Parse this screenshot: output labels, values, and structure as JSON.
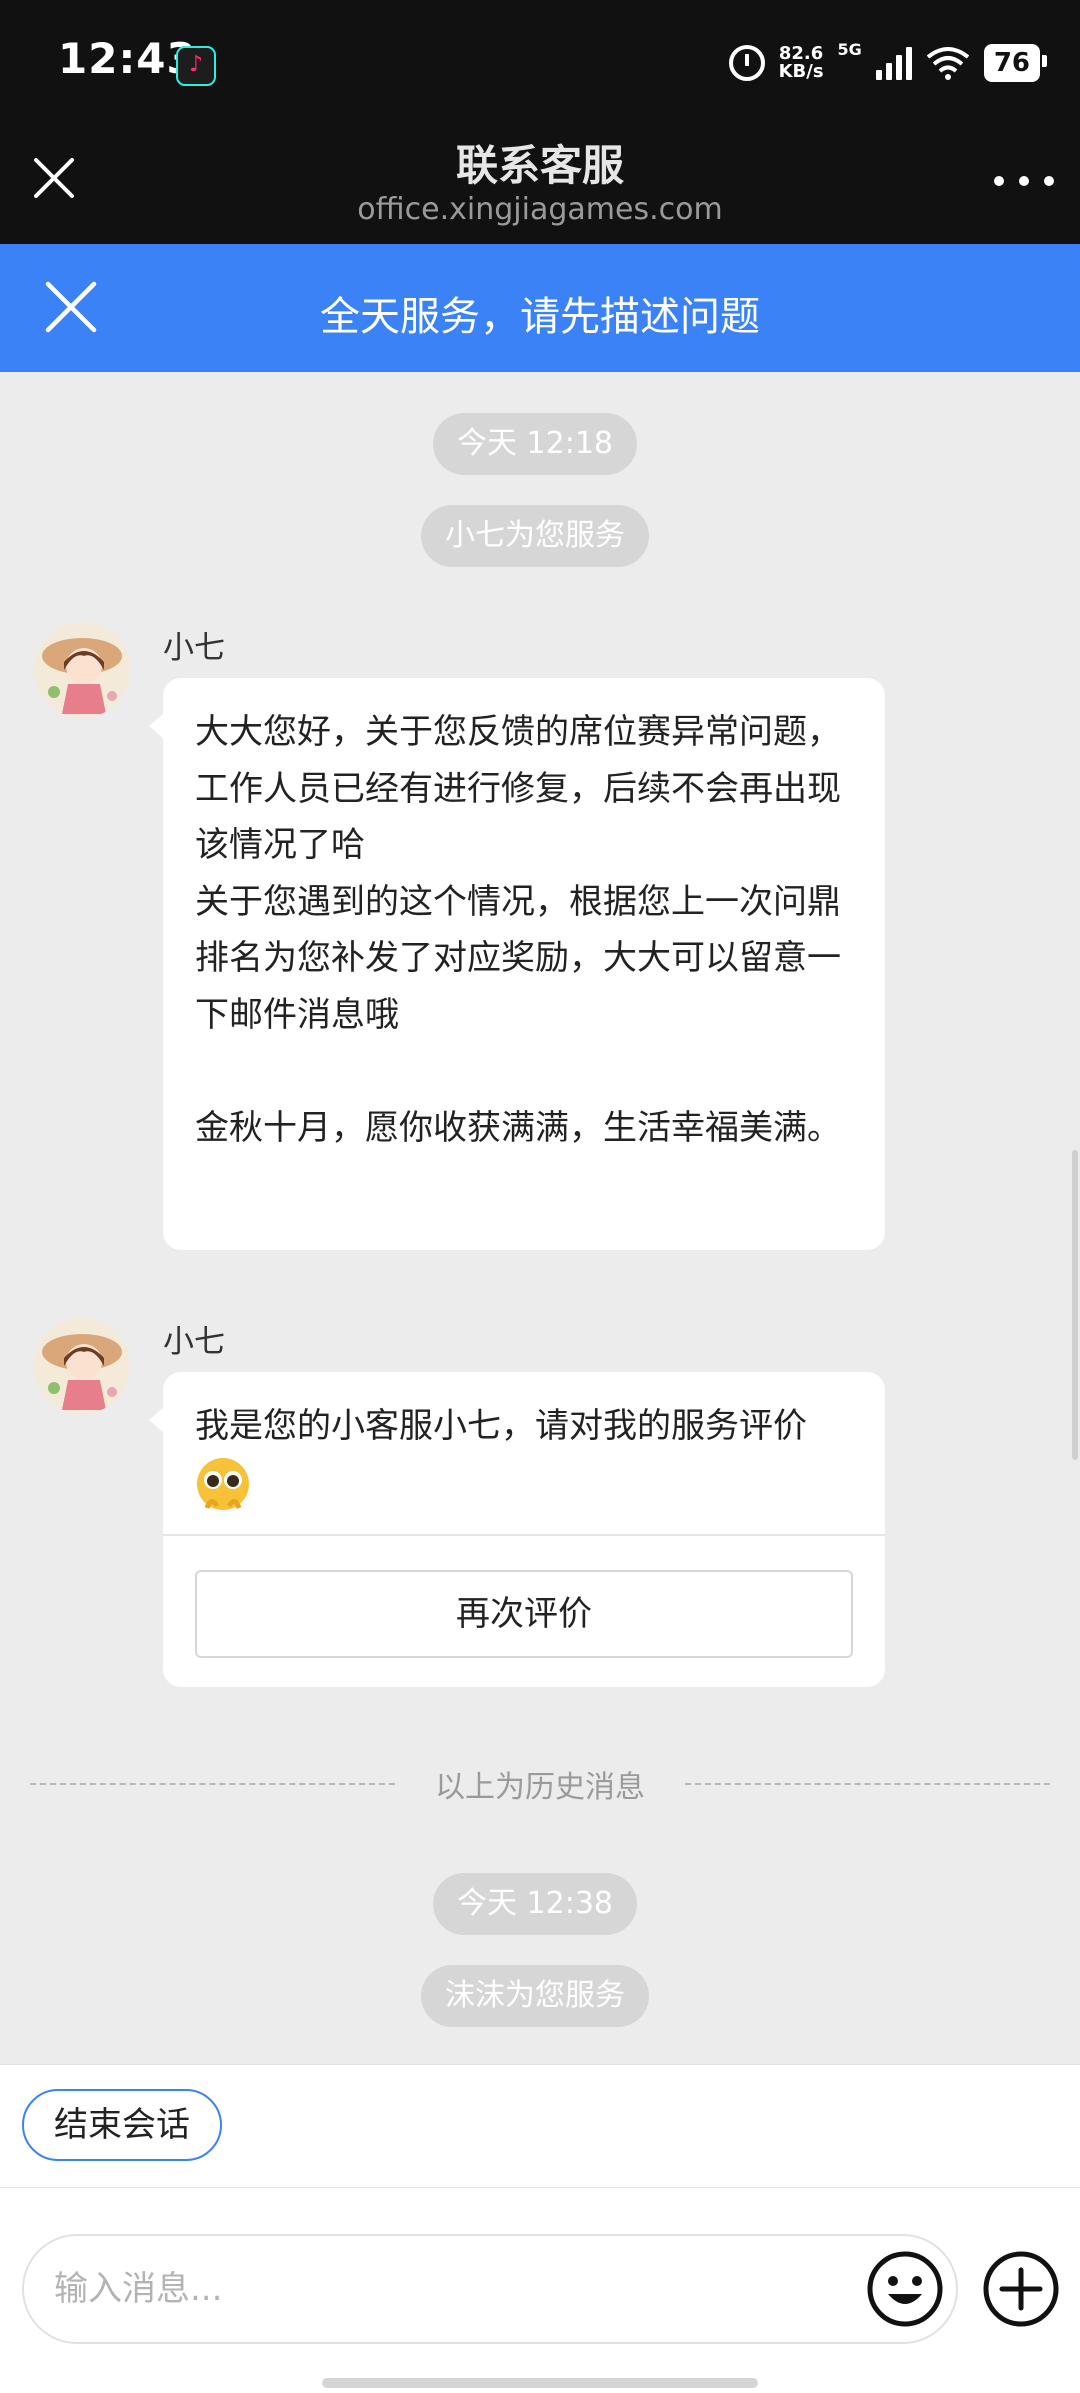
{
  "status_bar": {
    "time": "12:43",
    "app_icon": "tiktok-icon",
    "net_speed_value": "82.6",
    "net_speed_unit": "KB/s",
    "network": "5G",
    "battery": "76"
  },
  "header": {
    "title": "联系客服",
    "url": "office.xingjiagames.com",
    "close_icon": "close-icon",
    "more_icon": "more-icon"
  },
  "banner": {
    "text": "全天服务，请先描述问题",
    "close_icon": "close-icon"
  },
  "chat": {
    "session1_time": "今天 12:18",
    "session1_agent": "小七为您服务",
    "messages": [
      {
        "sender": "小七",
        "text": "大大您好，关于您反馈的席位赛异常问题，工作人员已经有进行修复，后续不会再出现该情况了哈\n关于您遇到的这个情况，根据您上一次问鼎排名为您补发了对应奖励，大大可以留意一下邮件消息哦\n\n金秋十月，愿你收获满满，生活幸福美满。"
      },
      {
        "sender": "小七",
        "text": "我是您的小客服小七，请对我的服务评价",
        "button": "再次评价"
      }
    ],
    "history_divider": "以上为历史消息",
    "session2_time": "今天 12:38",
    "session2_agent": "沫沫为您服务"
  },
  "footer": {
    "end_button": "结束会话",
    "input_placeholder": "输入消息..."
  },
  "colors": {
    "accent": "#3b82f6",
    "header_bg": "#111111",
    "chat_bg": "#ececec"
  }
}
